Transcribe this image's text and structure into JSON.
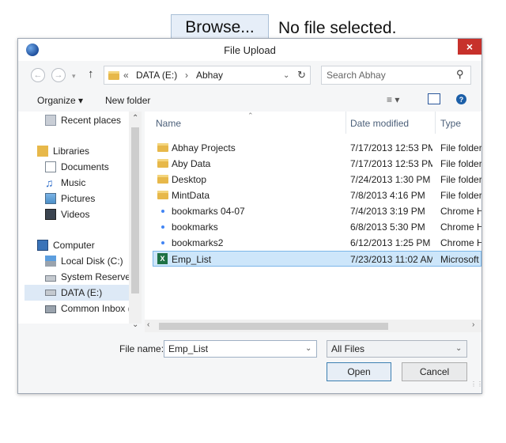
{
  "page": {
    "browse_label": "Browse...",
    "no_file_text": "No file selected."
  },
  "dialog": {
    "title": "File Upload",
    "close_glyph": "×",
    "address": {
      "prefix": "«",
      "crumbs": [
        "DATA (E:)",
        "Abhay"
      ],
      "separator": "›"
    },
    "search_placeholder": "Search Abhay",
    "toolbar": {
      "organize": "Organize ▾",
      "new_folder": "New folder"
    },
    "nav": [
      {
        "label": "Recent places",
        "icon": "recent-places-icon"
      },
      {
        "label": "Libraries",
        "icon": "libraries-icon"
      },
      {
        "label": "Documents",
        "icon": "documents-icon"
      },
      {
        "label": "Music",
        "icon": "music-icon"
      },
      {
        "label": "Pictures",
        "icon": "pictures-icon"
      },
      {
        "label": "Videos",
        "icon": "videos-icon"
      },
      {
        "label": "Computer",
        "icon": "computer-icon"
      },
      {
        "label": "Local Disk (C:)",
        "icon": "local-disk-icon"
      },
      {
        "label": "System Reserved",
        "icon": "drive-icon"
      },
      {
        "label": "DATA (E:)",
        "icon": "drive-icon"
      },
      {
        "label": "Common Inbox (",
        "icon": "network-drive-icon"
      }
    ],
    "columns": {
      "name": "Name",
      "date": "Date modified",
      "type": "Type"
    },
    "files": [
      {
        "name": "Abhay Projects",
        "date": "7/17/2013 12:53 PM",
        "type": "File folder",
        "icon": "folder-icon"
      },
      {
        "name": "Aby Data",
        "date": "7/17/2013 12:53 PM",
        "type": "File folder",
        "icon": "folder-icon"
      },
      {
        "name": "Desktop",
        "date": "7/24/2013 1:30 PM",
        "type": "File folder",
        "icon": "folder-icon"
      },
      {
        "name": "MintData",
        "date": "7/8/2013 4:16 PM",
        "type": "File folder",
        "icon": "folder-icon"
      },
      {
        "name": "bookmarks 04-07",
        "date": "7/4/2013 3:19 PM",
        "type": "Chrome H",
        "icon": "chrome-icon"
      },
      {
        "name": "bookmarks",
        "date": "6/8/2013 5:30 PM",
        "type": "Chrome H",
        "icon": "chrome-icon"
      },
      {
        "name": "bookmarks2",
        "date": "6/12/2013 1:25 PM",
        "type": "Chrome H",
        "icon": "chrome-icon"
      },
      {
        "name": "Emp_List",
        "date": "7/23/2013 11:02 AM",
        "type": "Microsoft",
        "icon": "excel-icon"
      }
    ],
    "file_name_label": "File name:",
    "file_name_value": "Emp_List",
    "filter_value": "All Files",
    "open_label": "Open",
    "cancel_label": "Cancel"
  }
}
